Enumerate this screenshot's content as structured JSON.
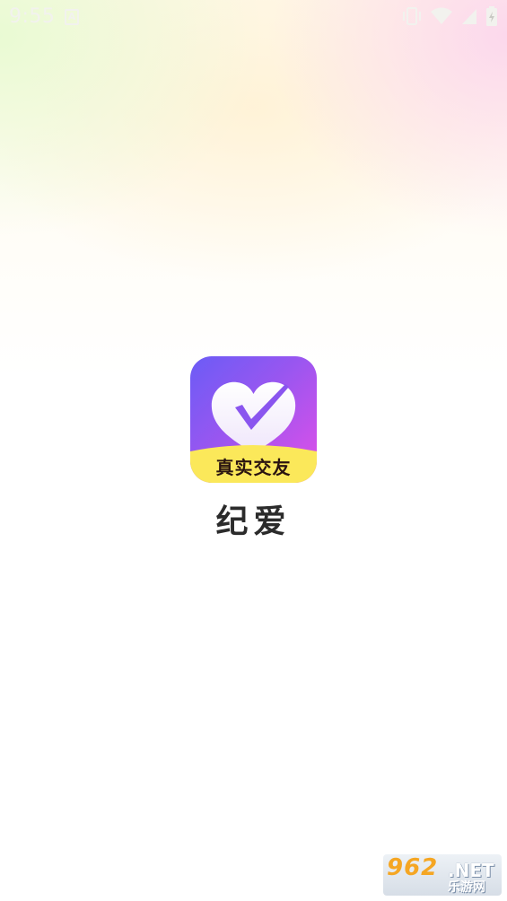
{
  "status_bar": {
    "time": "9:55",
    "notification_icon": "A",
    "icons": [
      "vibrate-icon",
      "wifi-icon",
      "signal-icon",
      "battery-icon"
    ]
  },
  "splash": {
    "app_icon": {
      "icon": "heart-check-icon",
      "banner_text": "真实交友",
      "gradient": [
        "#6b5cf6",
        "#9a56f0",
        "#e24fe8"
      ],
      "banner_color": "#fbe85a"
    },
    "app_name": "纪爱"
  },
  "watermark": {
    "number": "962",
    "domain": ".NET",
    "name": "乐游网"
  }
}
